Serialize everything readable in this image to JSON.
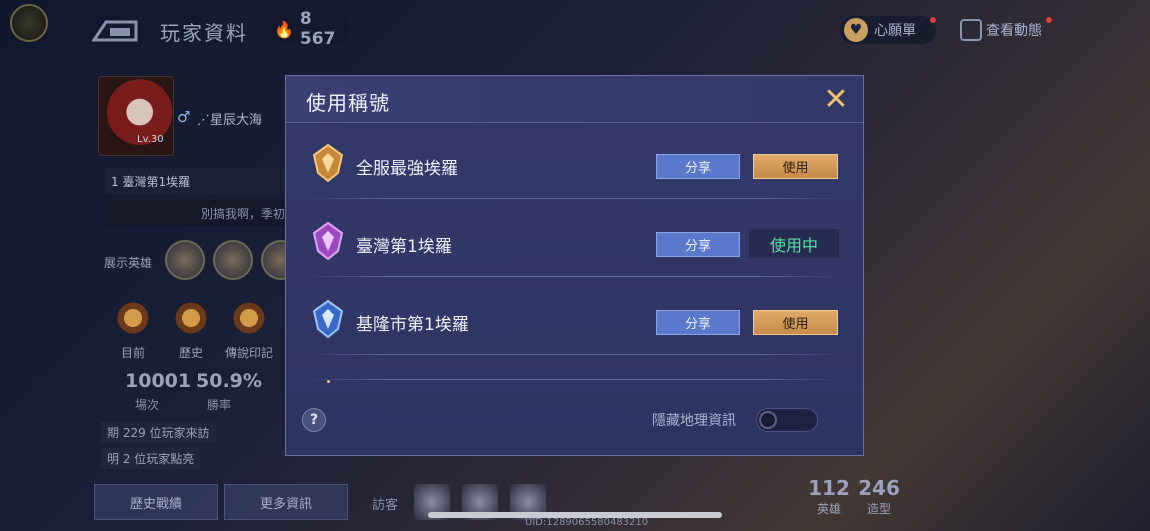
{
  "header": {
    "title": "玩家資料",
    "currency_value": "8 567",
    "wishlist_label": "心願單",
    "feed_label": "查看動態"
  },
  "profile": {
    "level": "Lv.30",
    "nickname": "⋰星辰大海",
    "rank_text": "1 臺灣第1埃羅",
    "motto": "別搞我啊，季初從",
    "hero_label": "展示英雄",
    "badges": [
      "目前",
      "歷史",
      "傳說印記"
    ],
    "stats": [
      {
        "value": "10001",
        "label": "場次"
      },
      {
        "value": "50.9%",
        "label": "勝率"
      }
    ],
    "visits_text": "期 229 位玩家來訪",
    "likes_text": "明 2 位玩家點亮",
    "history_button": "歷史戰績",
    "more_button": "更多資訊"
  },
  "visitors_label": "訪客",
  "counts": [
    {
      "value": "112",
      "label": "英雄"
    },
    {
      "value": "246",
      "label": "造型"
    }
  ],
  "uid_text": "UID:1289065580483210",
  "modal": {
    "title": "使用稱號",
    "close_icon": "close-icon",
    "rows": [
      {
        "name": "全服最強埃羅",
        "emblem": "gold-emblem-icon",
        "share": "分享",
        "action": "使用",
        "state": "available"
      },
      {
        "name": "臺灣第1埃羅",
        "emblem": "purple-emblem-icon",
        "share": "分享",
        "action": "使用中",
        "state": "in-use"
      },
      {
        "name": "基隆市第1埃羅",
        "emblem": "blue-emblem-icon",
        "share": "分享",
        "action": "使用",
        "state": "available"
      }
    ],
    "help_label": "?",
    "hide_geo_label": "隱藏地理資訊",
    "hide_geo_on": false
  },
  "colors": {
    "accent_gold": "#f0c070",
    "share_blue": "#5a78cc",
    "in_use_green": "#54e0a0",
    "modal_bg": "#34396a"
  }
}
